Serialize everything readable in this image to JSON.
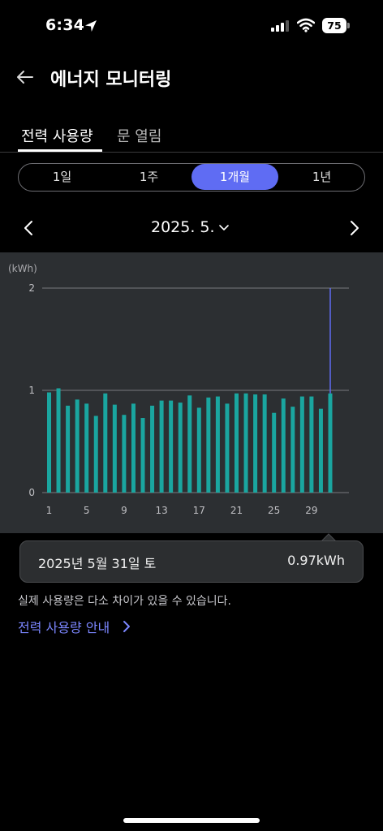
{
  "status_bar": {
    "time": "6:34",
    "battery": "75"
  },
  "header": {
    "title": "에너지 모니터링"
  },
  "tabs": [
    {
      "label": "전력 사용량",
      "active": true
    },
    {
      "label": "문 열림",
      "active": false
    }
  ],
  "period": {
    "options": [
      "1일",
      "1주",
      "1개월",
      "1년"
    ],
    "selected": "1개월"
  },
  "month_nav": {
    "label": "2025. 5."
  },
  "chart_data": {
    "type": "bar",
    "unit_label": "(kWh)",
    "ylim": [
      0,
      2
    ],
    "y_ticks": [
      "0",
      "1",
      "2"
    ],
    "x_tick_labels": [
      "1",
      "5",
      "9",
      "13",
      "17",
      "21",
      "25",
      "29"
    ],
    "x": [
      1,
      2,
      3,
      4,
      5,
      6,
      7,
      8,
      9,
      10,
      11,
      12,
      13,
      14,
      15,
      16,
      17,
      18,
      19,
      20,
      21,
      22,
      23,
      24,
      25,
      26,
      27,
      28,
      29,
      30,
      31
    ],
    "values": [
      0.98,
      1.02,
      0.85,
      0.91,
      0.87,
      0.75,
      0.97,
      0.86,
      0.76,
      0.87,
      0.73,
      0.85,
      0.9,
      0.9,
      0.88,
      0.95,
      0.83,
      0.93,
      0.94,
      0.87,
      0.97,
      0.97,
      0.96,
      0.96,
      0.78,
      0.92,
      0.84,
      0.94,
      0.94,
      0.82,
      0.97
    ],
    "selected_x": 31,
    "bar_color": "#1aa6a0",
    "highlight_color": "#5f6cf3"
  },
  "tooltip": {
    "date": "2025년 5월 31일 토",
    "value": "0.97kWh"
  },
  "note": "실제 사용량은 다소 차이가 있을 수 있습니다.",
  "guide_link": "전력 사용량 안내"
}
